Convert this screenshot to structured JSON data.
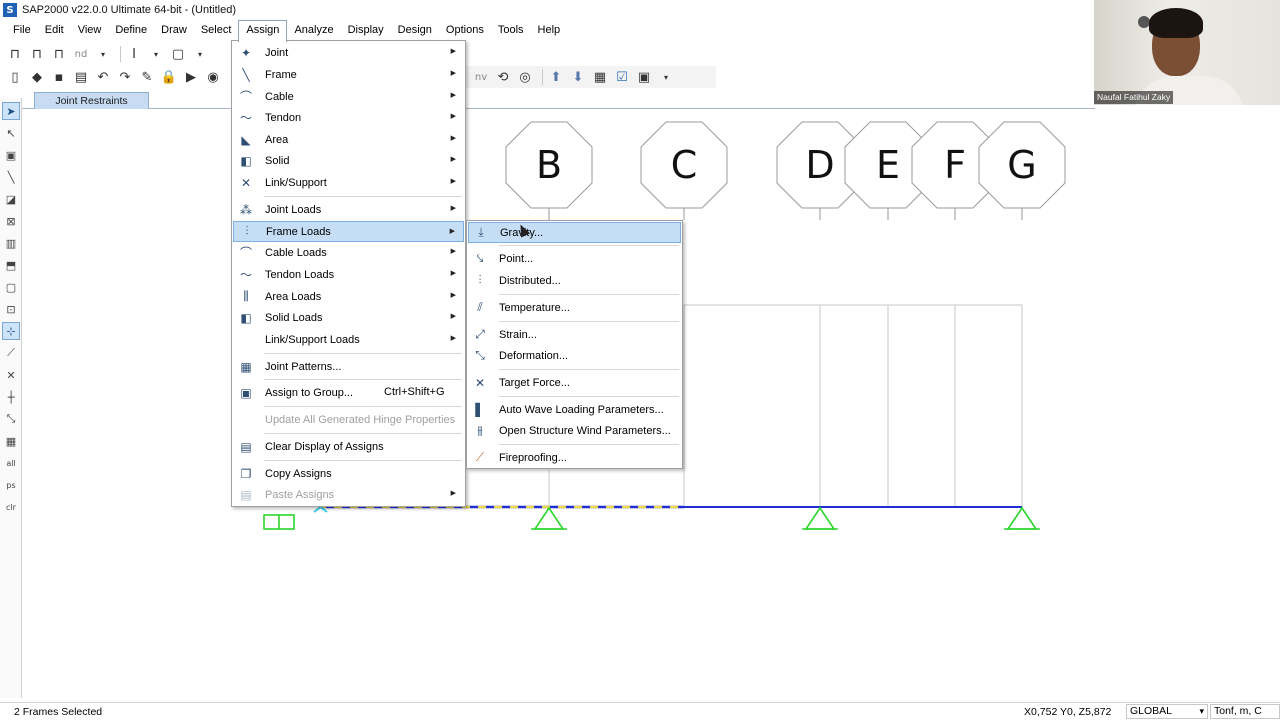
{
  "window": {
    "title": "SAP2000 v22.0.0 Ultimate 64-bit - (Untitled)",
    "logo_letter": "S"
  },
  "menubar": [
    "File",
    "Edit",
    "View",
    "Define",
    "Draw",
    "Select",
    "Assign",
    "Analyze",
    "Display",
    "Design",
    "Options",
    "Tools",
    "Help"
  ],
  "tab": {
    "label": "Joint Restraints"
  },
  "toolbar_row1": {
    "nd_label": "nd",
    "nv_label": "nv"
  },
  "grid_labels": [
    "B",
    "C",
    "D",
    "E",
    "F",
    "G"
  ],
  "assign_menu": {
    "items": [
      {
        "label": "Joint",
        "icon": "joint-icon",
        "submenu": true
      },
      {
        "label": "Frame",
        "icon": "frame-icon",
        "submenu": true
      },
      {
        "label": "Cable",
        "icon": "cable-icon",
        "submenu": true
      },
      {
        "label": "Tendon",
        "icon": "tendon-icon",
        "submenu": true
      },
      {
        "label": "Area",
        "icon": "area-icon",
        "submenu": true
      },
      {
        "label": "Solid",
        "icon": "solid-icon",
        "submenu": true
      },
      {
        "label": "Link/Support",
        "icon": "link-support-icon",
        "submenu": true
      },
      {
        "label": "Joint Loads",
        "icon": "joint-loads-icon",
        "submenu": true
      },
      {
        "label": "Frame Loads",
        "icon": "frame-loads-icon",
        "submenu": true,
        "highlighted": true
      },
      {
        "label": "Cable Loads",
        "icon": "cable-loads-icon",
        "submenu": true
      },
      {
        "label": "Tendon Loads",
        "icon": "tendon-loads-icon",
        "submenu": true
      },
      {
        "label": "Area Loads",
        "icon": "area-loads-icon",
        "submenu": true
      },
      {
        "label": "Solid Loads",
        "icon": "solid-loads-icon",
        "submenu": true
      },
      {
        "label": "Link/Support Loads",
        "icon": "link-support-loads-icon",
        "submenu": true
      },
      {
        "label": "Joint Patterns...",
        "icon": "joint-patterns-icon"
      },
      {
        "label": "Assign to Group...",
        "icon": "assign-group-icon",
        "shortcut": "Ctrl+Shift+G"
      },
      {
        "label": "Update All Generated Hinge Properties",
        "icon": "",
        "disabled": true
      },
      {
        "label": "Clear Display of Assigns",
        "icon": "clear-display-icon"
      },
      {
        "label": "Copy Assigns",
        "icon": "copy-assigns-icon"
      },
      {
        "label": "Paste Assigns",
        "icon": "paste-assigns-icon",
        "submenu": true,
        "disabled": true
      }
    ]
  },
  "frame_loads_submenu": {
    "items": [
      {
        "label": "Gravity...",
        "icon": "gravity-icon",
        "highlighted": true
      },
      {
        "label": "Point...",
        "icon": "point-load-icon"
      },
      {
        "label": "Distributed...",
        "icon": "distributed-load-icon"
      },
      {
        "label": "Temperature...",
        "icon": "temperature-icon"
      },
      {
        "label": "Strain...",
        "icon": "strain-icon"
      },
      {
        "label": "Deformation...",
        "icon": "deformation-icon"
      },
      {
        "label": "Target Force...",
        "icon": "target-force-icon"
      },
      {
        "label": "Auto Wave Loading Parameters...",
        "icon": "wave-loading-icon"
      },
      {
        "label": "Open Structure Wind Parameters...",
        "icon": "wind-parameters-icon"
      },
      {
        "label": "Fireproofing...",
        "icon": "fireproofing-icon"
      }
    ]
  },
  "statusbar": {
    "selection": "2 Frames Selected",
    "coords": "X0,752  Y0,  Z5,872",
    "coord_system": "GLOBAL",
    "units": "Tonf, m, C"
  },
  "webcam": {
    "name": "Naufal Fatihul Zaky"
  },
  "colors": {
    "menu_highlight": "#c6def5",
    "support": "#2bd62b",
    "beam": "#1f2fd6",
    "dashed_beam": "#e8d84a"
  }
}
